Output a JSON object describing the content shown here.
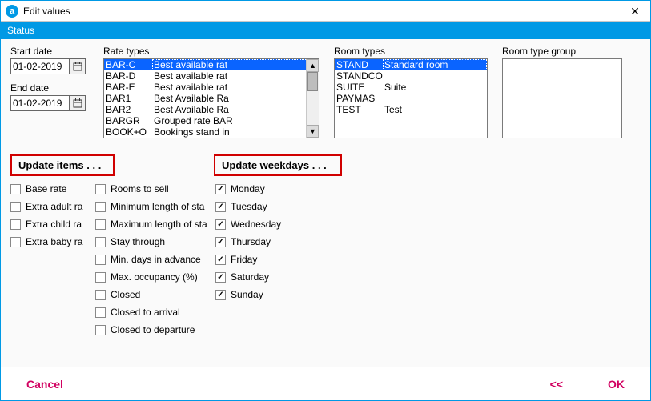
{
  "window": {
    "title": "Edit values",
    "app_icon": "a",
    "close": "✕"
  },
  "status": {
    "label": "Status"
  },
  "dates": {
    "start_label": "Start date",
    "start_value": "01-02-2019",
    "end_label": "End date",
    "end_value": "01-02-2019"
  },
  "rate_types": {
    "label": "Rate types",
    "selected_index": 0,
    "rows": [
      {
        "code": "BAR-C",
        "desc": "Best available rat"
      },
      {
        "code": "BAR-D",
        "desc": "Best available rat"
      },
      {
        "code": "BAR-E",
        "desc": "Best available rat"
      },
      {
        "code": "BAR1",
        "desc": "Best Available Ra"
      },
      {
        "code": "BAR2",
        "desc": "Best Available Ra"
      },
      {
        "code": "BARGR",
        "desc": "Grouped rate BAR"
      },
      {
        "code": "BOOK+O",
        "desc": "Bookings stand in"
      }
    ]
  },
  "room_types": {
    "label": "Room types",
    "selected_index": 0,
    "rows": [
      {
        "code": "STAND",
        "desc": "Standard room"
      },
      {
        "code": "STANDCO",
        "desc": ""
      },
      {
        "code": "SUITE",
        "desc": "Suite"
      },
      {
        "code": "PAYMAS",
        "desc": ""
      },
      {
        "code": "TEST",
        "desc": "Test"
      }
    ]
  },
  "room_type_group": {
    "label": "Room type group"
  },
  "sections": {
    "update_items": "Update items . . .",
    "update_weekdays": "Update weekdays . . ."
  },
  "items_col1": [
    {
      "label": "Base rate",
      "checked": false
    },
    {
      "label": "Extra adult ra",
      "checked": false
    },
    {
      "label": "Extra child ra",
      "checked": false
    },
    {
      "label": "Extra baby ra",
      "checked": false
    }
  ],
  "items_col2": [
    {
      "label": "Rooms to sell",
      "checked": false
    },
    {
      "label": "Minimum length of sta",
      "checked": false
    },
    {
      "label": "Maximum length of sta",
      "checked": false
    },
    {
      "label": "Stay through",
      "checked": false
    },
    {
      "label": "Min. days in advance",
      "checked": false
    },
    {
      "label": "Max. occupancy (%)",
      "checked": false
    },
    {
      "label": "Closed",
      "checked": false
    },
    {
      "label": "Closed to arrival",
      "checked": false
    },
    {
      "label": "Closed to departure",
      "checked": false
    }
  ],
  "weekdays": [
    {
      "label": "Monday",
      "checked": true
    },
    {
      "label": "Tuesday",
      "checked": true
    },
    {
      "label": "Wednesday",
      "checked": true
    },
    {
      "label": "Thursday",
      "checked": true
    },
    {
      "label": "Friday",
      "checked": true
    },
    {
      "label": "Saturday",
      "checked": true
    },
    {
      "label": "Sunday",
      "checked": true
    }
  ],
  "footer": {
    "cancel": "Cancel",
    "prev": "<<",
    "ok": "OK"
  }
}
